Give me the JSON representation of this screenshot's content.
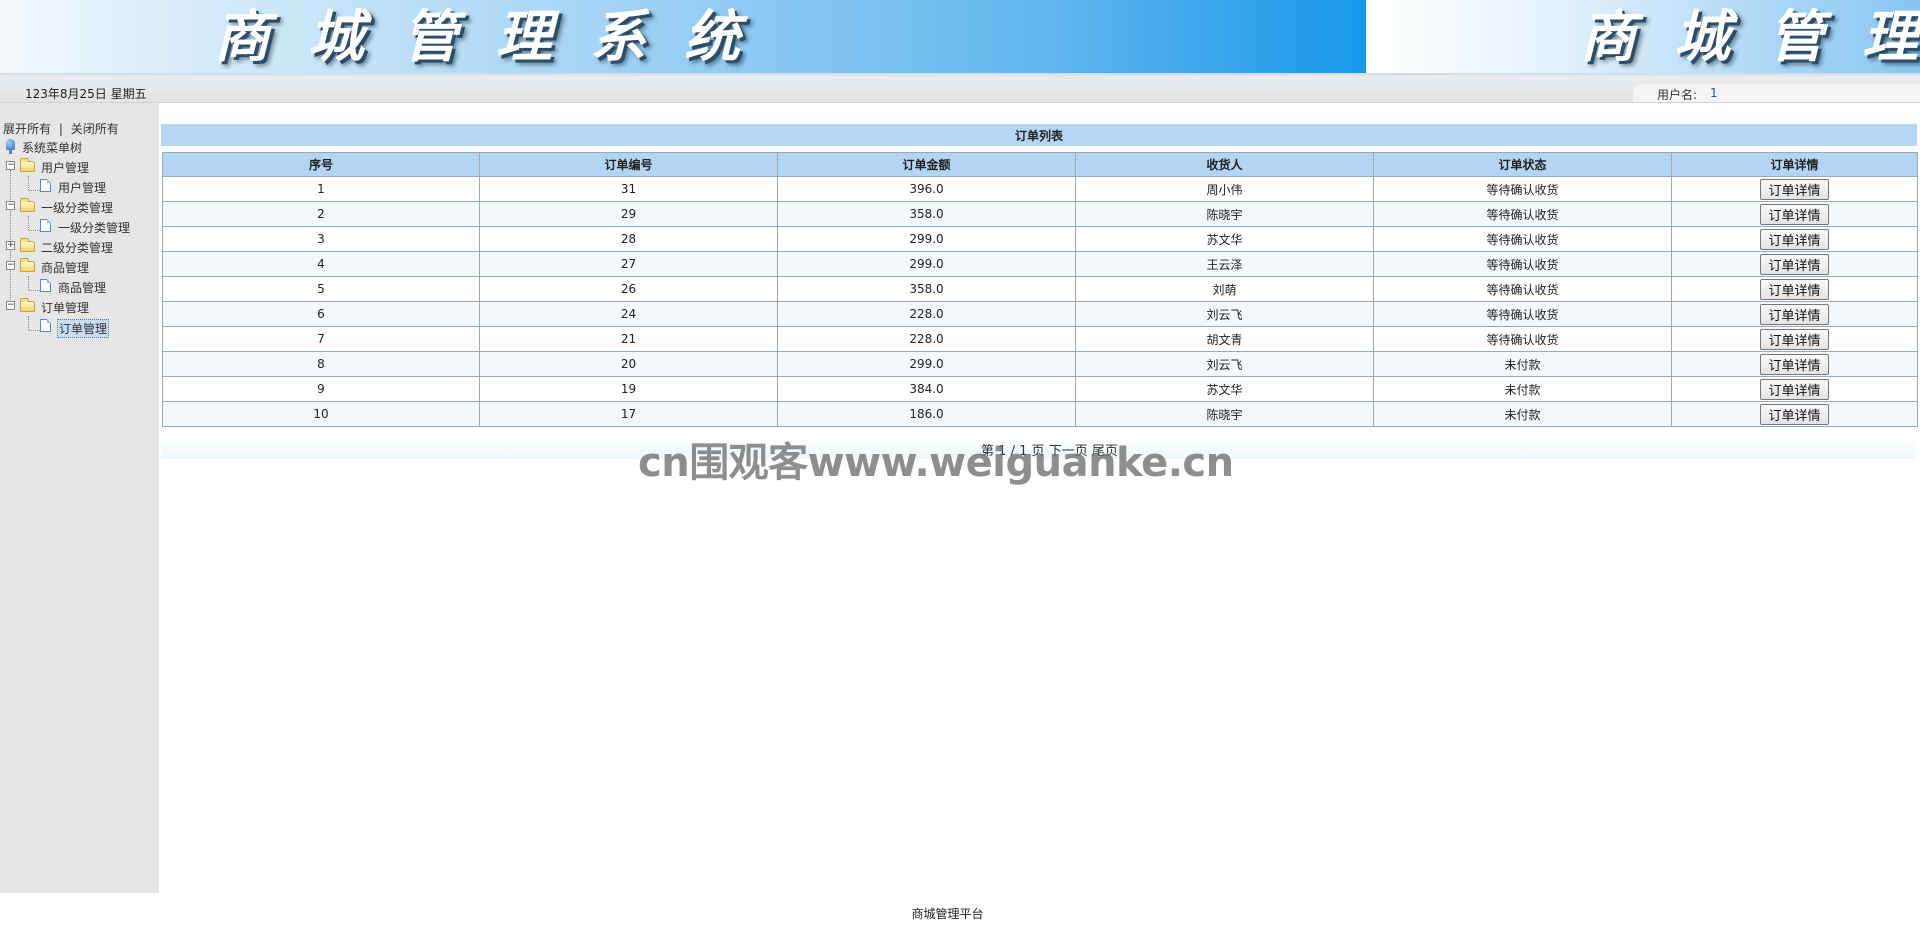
{
  "header": {
    "title": "商城管理系统",
    "title_repeat": "商城管理"
  },
  "status_bar": {
    "date": "123年8月25日 星期五",
    "user_label": "用户名:",
    "user_value": "1"
  },
  "sidebar": {
    "expand_all": "展开所有",
    "separator": "|",
    "collapse_all": "关闭所有",
    "root_label": "系统菜单树",
    "nodes": [
      {
        "label": "用户管理",
        "expanded": true,
        "children": [
          "用户管理"
        ]
      },
      {
        "label": "一级分类管理",
        "expanded": true,
        "children": [
          "一级分类管理"
        ]
      },
      {
        "label": "二级分类管理",
        "expanded": false,
        "children": []
      },
      {
        "label": "商品管理",
        "expanded": true,
        "children": [
          "商品管理"
        ]
      },
      {
        "label": "订单管理",
        "expanded": true,
        "children": [
          "订单管理"
        ],
        "selected_child": 0
      }
    ]
  },
  "content": {
    "list_title": "订单列表",
    "columns": [
      "序号",
      "订单编号",
      "订单金额",
      "收货人",
      "订单状态",
      "订单详情"
    ],
    "detail_button_label": "订单详情",
    "rows": [
      [
        "1",
        "31",
        "396.0",
        "周小伟",
        "等待确认收货"
      ],
      [
        "2",
        "29",
        "358.0",
        "陈晓宇",
        "等待确认收货"
      ],
      [
        "3",
        "28",
        "299.0",
        "苏文华",
        "等待确认收货"
      ],
      [
        "4",
        "27",
        "299.0",
        "王云泽",
        "等待确认收货"
      ],
      [
        "5",
        "26",
        "358.0",
        "刘萌",
        "等待确认收货"
      ],
      [
        "6",
        "24",
        "228.0",
        "刘云飞",
        "等待确认收货"
      ],
      [
        "7",
        "21",
        "228.0",
        "胡文青",
        "等待确认收货"
      ],
      [
        "8",
        "20",
        "299.0",
        "刘云飞",
        "未付款"
      ],
      [
        "9",
        "19",
        "384.0",
        "苏文华",
        "未付款"
      ],
      [
        "10",
        "17",
        "186.0",
        "陈晓宇",
        "未付款"
      ]
    ],
    "pager": {
      "page_text": "第",
      "current_page": "1",
      "slash": "/",
      "total_pages": "1",
      "page_suffix": "页",
      "next_label": "下一页",
      "last_label": "尾页"
    }
  },
  "watermark": "cn围观客www.weiguanke.cn",
  "footer": "商城管理平台",
  "colors": {
    "banner_blue": "#159ae9",
    "table_header": "#b3d4f3",
    "sidebar_bg": "#e6e6e6",
    "user_value": "#1a55cc"
  }
}
